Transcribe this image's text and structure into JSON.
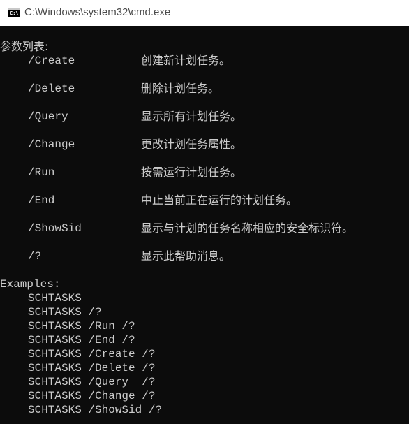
{
  "window": {
    "title": "C:\\Windows\\system32\\cmd.exe",
    "icon": "cmd-app-icon",
    "icon_text": "C:\\"
  },
  "console": {
    "param_heading": "参数列表:",
    "params": [
      {
        "name": "/Create",
        "desc": "创建新计划任务。"
      },
      {
        "name": "/Delete",
        "desc": "删除计划任务。"
      },
      {
        "name": "/Query",
        "desc": "显示所有计划任务。"
      },
      {
        "name": "/Change",
        "desc": "更改计划任务属性。"
      },
      {
        "name": "/Run",
        "desc": "按需运行计划任务。"
      },
      {
        "name": "/End",
        "desc": "中止当前正在运行的计划任务。"
      },
      {
        "name": "/ShowSid",
        "desc": "显示与计划的任务名称相应的安全标识符。"
      },
      {
        "name": "/?",
        "desc": "显示此帮助消息。"
      }
    ],
    "examples_heading": "Examples:",
    "examples": [
      "SCHTASKS",
      "SCHTASKS /?",
      "SCHTASKS /Run /?",
      "SCHTASKS /End /?",
      "SCHTASKS /Create /?",
      "SCHTASKS /Delete /?",
      "SCHTASKS /Query  /?",
      "SCHTASKS /Change /?",
      "SCHTASKS /ShowSid /?"
    ]
  },
  "colors": {
    "console_bg": "#0c0c0c",
    "console_fg": "#cccccc",
    "titlebar_bg": "#ffffff",
    "title_fg": "#4a4a4a"
  }
}
